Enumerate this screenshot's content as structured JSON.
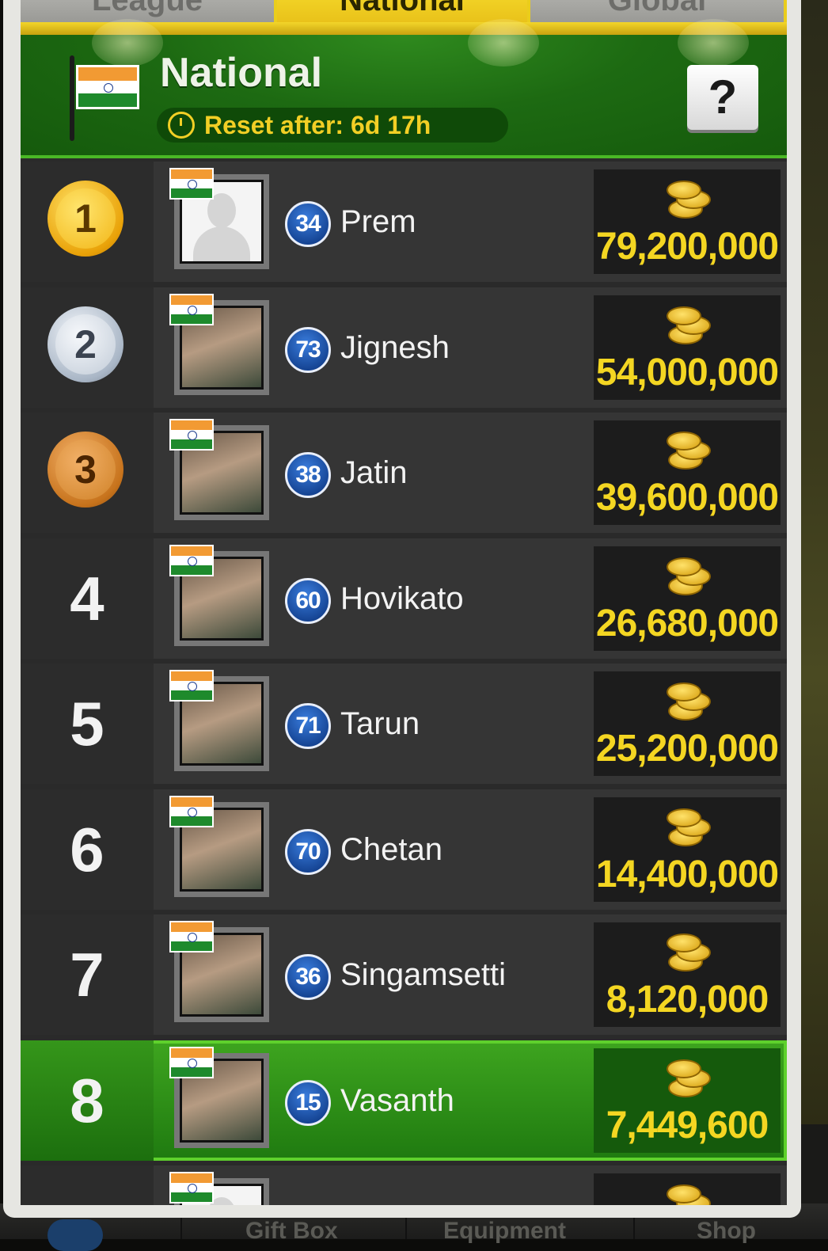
{
  "tabs": [
    {
      "label": "League",
      "active": false
    },
    {
      "label": "National",
      "active": true
    },
    {
      "label": "Global",
      "active": false
    }
  ],
  "header": {
    "title": "National",
    "reset_text": "Reset after: 6d 17h",
    "help_label": "?",
    "flag_icon": "india-flag-icon"
  },
  "rows": [
    {
      "rank": "1",
      "medal": "gold",
      "level": "34",
      "name": "Prem",
      "coins": "79,200,000",
      "avatar": "default"
    },
    {
      "rank": "2",
      "medal": "silver",
      "level": "73",
      "name": "Jignesh",
      "coins": "54,000,000",
      "avatar": "photo"
    },
    {
      "rank": "3",
      "medal": "bronze",
      "level": "38",
      "name": "Jatin",
      "coins": "39,600,000",
      "avatar": "photo"
    },
    {
      "rank": "4",
      "medal": "",
      "level": "60",
      "name": "Hovikato",
      "coins": "26,680,000",
      "avatar": "photo"
    },
    {
      "rank": "5",
      "medal": "",
      "level": "71",
      "name": "Tarun",
      "coins": "25,200,000",
      "avatar": "photo"
    },
    {
      "rank": "6",
      "medal": "",
      "level": "70",
      "name": "Chetan",
      "coins": "14,400,000",
      "avatar": "photo"
    },
    {
      "rank": "7",
      "medal": "",
      "level": "36",
      "name": "Singamsetti",
      "coins": "8,120,000",
      "avatar": "photo"
    },
    {
      "rank": "8",
      "medal": "",
      "level": "15",
      "name": "Vasanth",
      "coins": "7,449,600",
      "avatar": "photo",
      "current_user": true
    }
  ],
  "bottom_nav": [
    {
      "label": "Gift Box"
    },
    {
      "label": "Equipment"
    },
    {
      "label": "Shop"
    }
  ],
  "colors": {
    "header_green": "#1d6a12",
    "tab_yellow": "#eacd1c",
    "coin_text": "#f4d622",
    "highlight_green": "#3ea51f"
  }
}
